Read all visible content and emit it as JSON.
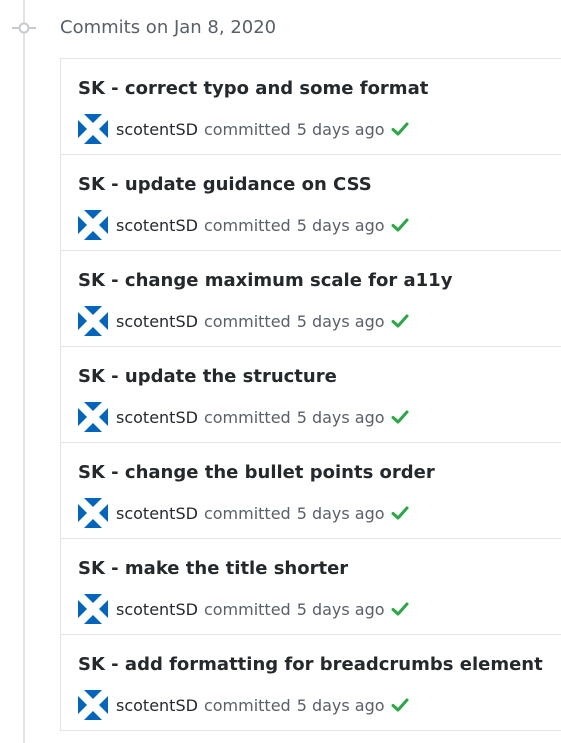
{
  "group": {
    "title": "Commits on Jan 8, 2020"
  },
  "commits": [
    {
      "title": "SK - correct typo and some format",
      "author": "scotentSD",
      "committed": "committed",
      "time": "5 days ago"
    },
    {
      "title": "SK - update guidance on CSS",
      "author": "scotentSD",
      "committed": "committed",
      "time": "5 days ago"
    },
    {
      "title": "SK - change maximum scale for a11y",
      "author": "scotentSD",
      "committed": "committed",
      "time": "5 days ago"
    },
    {
      "title": "SK - update the structure",
      "author": "scotentSD",
      "committed": "committed",
      "time": "5 days ago"
    },
    {
      "title": "SK - change the bullet points order",
      "author": "scotentSD",
      "committed": "committed",
      "time": "5 days ago"
    },
    {
      "title": "SK - make the title shorter",
      "author": "scotentSD",
      "committed": "committed",
      "time": "5 days ago"
    },
    {
      "title": "SK - add formatting for breadcrumbs element",
      "author": "scotentSD",
      "committed": "committed",
      "time": "5 days ago"
    }
  ],
  "icons": {
    "avatar": "saltire-avatar-icon",
    "status": "check-icon",
    "timeline": "git-commit-icon"
  },
  "colors": {
    "avatar_blue": "#0065bd",
    "check_green": "#28a745",
    "border": "#e1e4e8",
    "muted_text": "#586069",
    "main_text": "#24292e"
  }
}
